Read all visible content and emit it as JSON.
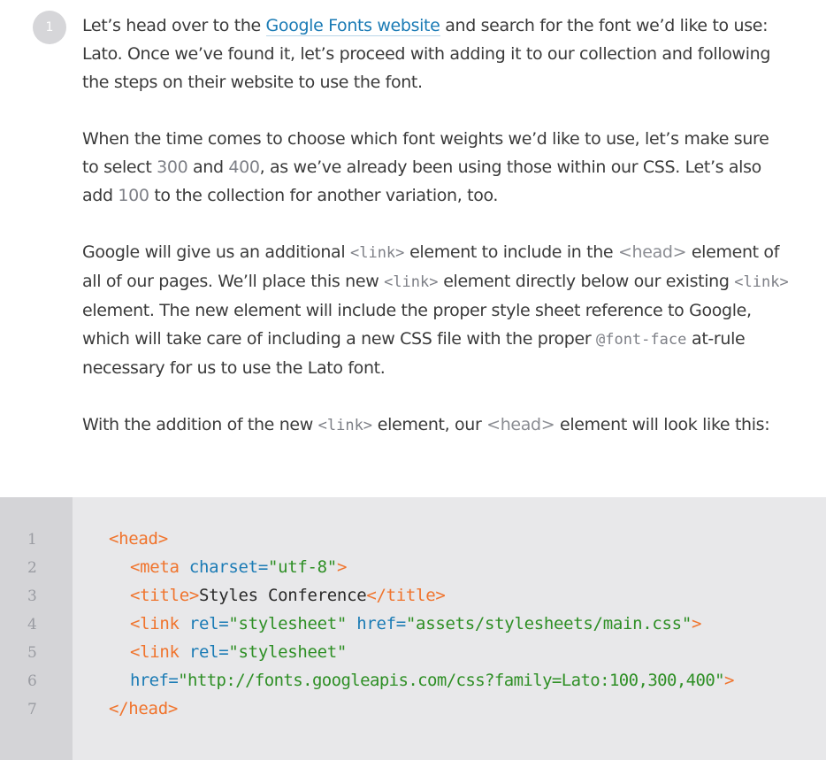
{
  "step": {
    "number": "1"
  },
  "paragraphs": {
    "p1": {
      "a": "Let’s head over to the ",
      "link": "Google Fonts website",
      "b": " and search for the font we’d like to use: Lato. Once we’ve found it, let’s proceed with adding it to our collection and following the steps on their website to use the font."
    },
    "p2": {
      "a": "When the time comes to choose which font weights we’d like to use, let’s make sure to select ",
      "w300": "300",
      "b": " and ",
      "w400": "400",
      "c": ", as we’ve already been using those within our CSS. Let’s also add ",
      "w100": "100",
      "d": " to the collection for another variation, too."
    },
    "p3": {
      "a": "Google will give us an additional ",
      "link1": "<link>",
      "b": " element to include in the ",
      "head1": "<head>",
      "c": " element of all of our pages. We’ll place this new ",
      "link2": "<link>",
      "d": " element directly below our existing ",
      "link3": "<link>",
      "e": " element. The new element will include the proper style sheet reference to Google, which will take care of including a new CSS file with the proper ",
      "fontface": "@font-face",
      "f": " at-rule necessary for us to use the Lato font."
    },
    "p4": {
      "a": "With the addition of the new ",
      "link": "<link>",
      "b": " element, our ",
      "head": "<head>",
      "c": " element will look like this:"
    }
  },
  "code": {
    "line_numbers": [
      "1",
      "2",
      "3",
      "4",
      "5",
      "6",
      "7"
    ],
    "l1": {
      "tag": "<head>"
    },
    "l2": {
      "open": "<meta",
      "attr": "charset=",
      "val": "\"utf-8\"",
      "close": ">"
    },
    "l3": {
      "open": "<title>",
      "text": "Styles Conference",
      "close": "</title>"
    },
    "l4": {
      "open": "<link",
      "attr1": "rel=",
      "val1": "\"stylesheet\"",
      "attr2": "href=",
      "val2": "\"assets/stylesheets/main.css\"",
      "close": ">"
    },
    "l5": {
      "open": "<link",
      "attr1": "rel=",
      "val1": "\"stylesheet\""
    },
    "l6": {
      "attr": "href=",
      "val": "\"http://fonts.googleapis.com/css?family=Lato:100,300,400\"",
      "close": ">"
    },
    "l7": {
      "tag": "</head>"
    }
  }
}
